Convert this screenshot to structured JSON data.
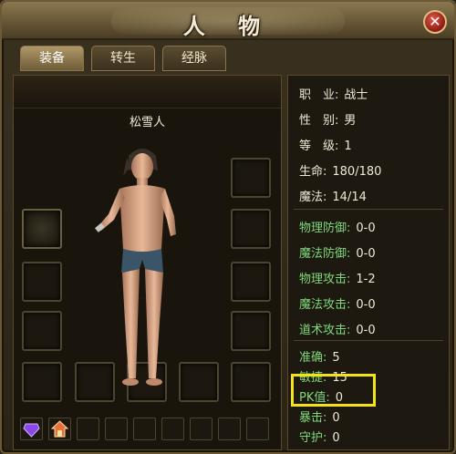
{
  "window": {
    "title": "人 物",
    "close_symbol": "✕"
  },
  "tabs": [
    {
      "label": "装备",
      "active": true
    },
    {
      "label": "转生",
      "active": false
    },
    {
      "label": "经脉",
      "active": false
    }
  ],
  "character": {
    "name": "松雪人"
  },
  "basic": [
    {
      "label": "职　业:",
      "value": "战士"
    },
    {
      "label": "性　别:",
      "value": "男"
    },
    {
      "label": "等　级:",
      "value": "1"
    },
    {
      "label": "生命:",
      "value": "180/180"
    },
    {
      "label": "魔法:",
      "value": "14/14"
    }
  ],
  "combat": [
    {
      "label": "物理防御:",
      "value": "0-0"
    },
    {
      "label": "魔法防御:",
      "value": "0-0"
    },
    {
      "label": "物理攻击:",
      "value": "1-2"
    },
    {
      "label": "魔法攻击:",
      "value": "0-0"
    },
    {
      "label": "道术攻击:",
      "value": "0-0"
    }
  ],
  "extra": [
    {
      "label": "准确:",
      "value": "5"
    },
    {
      "label": "敏捷:",
      "value": "15"
    },
    {
      "label": "PK值:",
      "value": "0"
    },
    {
      "label": "暴击:",
      "value": "0"
    },
    {
      "label": "守护:",
      "value": "0"
    }
  ],
  "colors": {
    "highlight": "#f5e31a",
    "green_label": "#7fd97a"
  }
}
